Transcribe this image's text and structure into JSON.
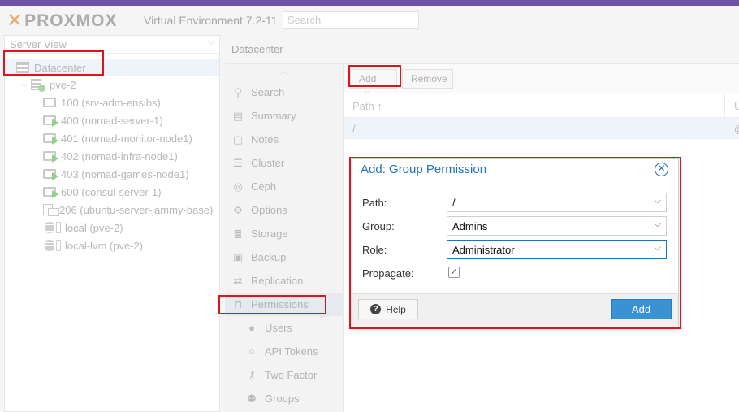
{
  "app": {
    "logo_text": "PROXMOX",
    "version": "Virtual Environment 7.2-11",
    "search_placeholder": "Search"
  },
  "left": {
    "view": "Server View",
    "tree": [
      {
        "label": "Datacenter",
        "icon": "datacenter-icon"
      },
      {
        "label": "pve-2",
        "icon": "node-online-icon"
      },
      {
        "label": "100 (srv-adm-ensibs)",
        "icon": "vm-stopped-icon"
      },
      {
        "label": "400 (nomad-server-1)",
        "icon": "vm-running-icon"
      },
      {
        "label": "401 (nomad-monitor-node1)",
        "icon": "vm-running-icon"
      },
      {
        "label": "402 (nomad-infra-node1)",
        "icon": "vm-running-icon"
      },
      {
        "label": "403 (nomad-games-node1)",
        "icon": "vm-running-icon"
      },
      {
        "label": "600 (consul-server-1)",
        "icon": "vm-running-icon"
      },
      {
        "label": "206 (ubuntu-server-jammy-base)",
        "icon": "template-icon"
      },
      {
        "label": "local (pve-2)",
        "icon": "storage-icon"
      },
      {
        "label": "local-lvm (pve-2)",
        "icon": "storage-icon"
      }
    ]
  },
  "header": {
    "title": "Datacenter"
  },
  "nav": [
    {
      "label": "Search",
      "icon": "search-icon"
    },
    {
      "label": "Summary",
      "icon": "summary-icon"
    },
    {
      "label": "Notes",
      "icon": "notes-icon"
    },
    {
      "label": "Cluster",
      "icon": "cluster-icon"
    },
    {
      "label": "Ceph",
      "icon": "ceph-icon"
    },
    {
      "label": "Options",
      "icon": "gear-icon"
    },
    {
      "label": "Storage",
      "icon": "database-icon"
    },
    {
      "label": "Backup",
      "icon": "floppy-icon"
    },
    {
      "label": "Replication",
      "icon": "retweet-icon"
    },
    {
      "label": "Permissions",
      "icon": "unlock-icon"
    },
    {
      "label": "Users",
      "icon": "user-icon"
    },
    {
      "label": "API Tokens",
      "icon": "user-outline-icon"
    },
    {
      "label": "Two Factor",
      "icon": "key-icon"
    },
    {
      "label": "Groups",
      "icon": "users-icon"
    }
  ],
  "toolbar": {
    "add": "Add",
    "remove": "Remove"
  },
  "grid": {
    "columns": [
      "Path",
      "U"
    ],
    "rows": [
      {
        "path": "/",
        "user": "@"
      }
    ]
  },
  "dialog": {
    "title": "Add: Group Permission",
    "fields": {
      "path_label": "Path:",
      "path_value": "/",
      "group_label": "Group:",
      "group_value": "Admins",
      "role_label": "Role:",
      "role_value": "Administrator",
      "propagate_label": "Propagate:",
      "propagate_checked": true
    },
    "help": "Help",
    "add": "Add"
  },
  "colors": {
    "accent": "#1f73bd",
    "primary_button": "#3892d4",
    "top_stripe": "#6b52a6",
    "highlight": "#d9151e"
  }
}
